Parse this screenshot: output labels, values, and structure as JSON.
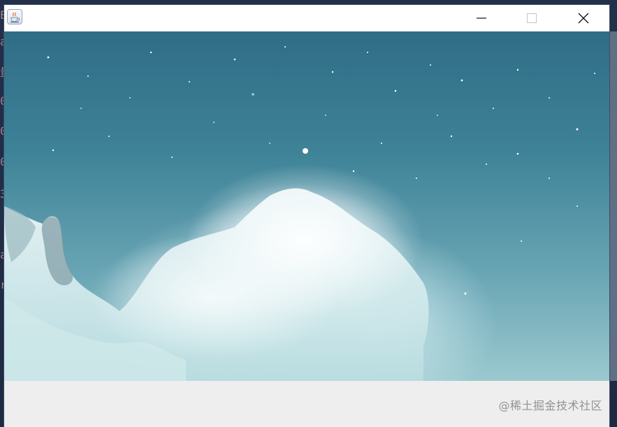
{
  "window": {
    "title": "",
    "controls": {
      "minimize_icon": "minimize-icon",
      "maximize_icon": "maximize-icon",
      "close_icon": "close-icon"
    }
  },
  "background_editor": {
    "lines": [
      "E",
      "a",
      "量",
      "0",
      "0",
      "0",
      "3",
      "a",
      "r"
    ]
  },
  "content": {
    "image_name": "nebula-image",
    "colors": {
      "sky_top": "#2f6d86",
      "sky_bottom": "#9bc9cf",
      "cloud": "#eaf6f8"
    }
  },
  "watermark": {
    "text": "@稀土掘金技术社区"
  }
}
